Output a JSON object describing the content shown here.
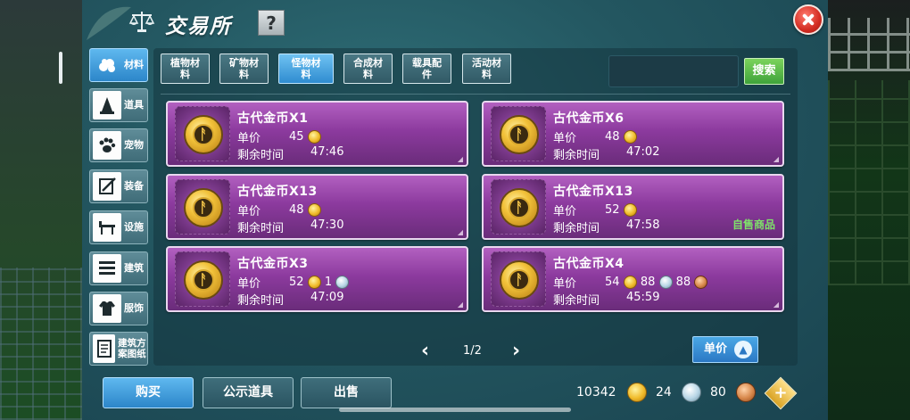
{
  "header": {
    "title": "交易所",
    "help_label": "?"
  },
  "sidebar": {
    "items": [
      {
        "label": "材料",
        "icon": "materials-icon",
        "active": true
      },
      {
        "label": "道具",
        "icon": "item-icon",
        "active": false
      },
      {
        "label": "宠物",
        "icon": "pet-paw-icon",
        "active": false
      },
      {
        "label": "装备",
        "icon": "equipment-icon",
        "active": false
      },
      {
        "label": "设施",
        "icon": "facility-icon",
        "active": false
      },
      {
        "label": "建筑",
        "icon": "building-icon",
        "active": false
      },
      {
        "label": "服饰",
        "icon": "clothing-icon",
        "active": false
      },
      {
        "label": "建筑方案图纸",
        "icon": "blueprint-icon",
        "active": false
      }
    ]
  },
  "tabs": [
    {
      "label": "植物材料",
      "active": false
    },
    {
      "label": "矿物材料",
      "active": false
    },
    {
      "label": "怪物材料",
      "active": true
    },
    {
      "label": "合成材料",
      "active": false
    },
    {
      "label": "载具配件",
      "active": false
    },
    {
      "label": "活动材料",
      "active": false
    }
  ],
  "search": {
    "button_label": "搜索",
    "placeholder": ""
  },
  "labels": {
    "unit_price": "单价",
    "remaining_time": "剩余时间"
  },
  "listings": [
    {
      "name": "古代金币X1",
      "gold": "45",
      "silver": "",
      "copper": "",
      "time": "47:46",
      "self_label": ""
    },
    {
      "name": "古代金币X6",
      "gold": "48",
      "silver": "",
      "copper": "",
      "time": "47:02",
      "self_label": ""
    },
    {
      "name": "古代金币X13",
      "gold": "48",
      "silver": "",
      "copper": "",
      "time": "47:30",
      "self_label": ""
    },
    {
      "name": "古代金币X13",
      "gold": "52",
      "silver": "",
      "copper": "",
      "time": "47:58",
      "self_label": "自售商品"
    },
    {
      "name": "古代金币X3",
      "gold": "52",
      "silver": "1",
      "copper": "",
      "time": "47:09",
      "self_label": ""
    },
    {
      "name": "古代金币X4",
      "gold": "54",
      "silver": "88",
      "copper": "88",
      "time": "45:59",
      "self_label": ""
    }
  ],
  "pager": {
    "text": "1/2",
    "prev": "‹",
    "next": "›"
  },
  "sort": {
    "label": "单价"
  },
  "bottom": {
    "buy": "购买",
    "public": "公示道具",
    "sell": "出售"
  },
  "currency": {
    "gold": "10342",
    "silver": "24",
    "copper": "80"
  },
  "colors": {
    "panel": "#235660",
    "card": "#8c3a9e",
    "active_tab": "#2f8cd0",
    "search_btn": "#3fa33a",
    "self_sale": "#7fe26a"
  }
}
